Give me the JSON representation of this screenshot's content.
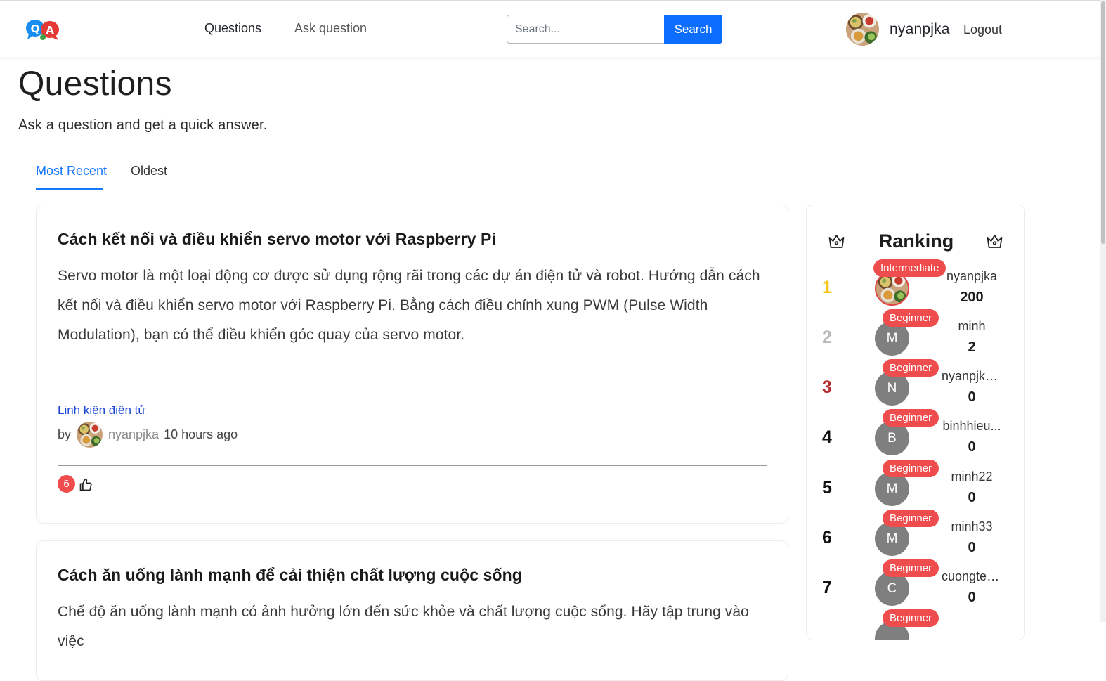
{
  "nav": {
    "links": [
      {
        "label": "Questions"
      },
      {
        "label": "Ask question"
      }
    ],
    "search_placeholder": "Search...",
    "search_button": "Search",
    "username": "nyanpjka",
    "logout": "Logout"
  },
  "header": {
    "title": "Questions",
    "subtitle": "Ask a question and get a quick answer."
  },
  "tabs": [
    {
      "label": "Most Recent",
      "active": true
    },
    {
      "label": "Oldest",
      "active": false
    }
  ],
  "questions": [
    {
      "title": "Cách kết nối và điều khiển servo motor với Raspberry Pi",
      "body": "Servo motor là một loại động cơ được sử dụng rộng rãi trong các dự án điện tử và robot. Hướng dẫn cách kết nối và điều khiển servo motor với Raspberry Pi. Bằng cách điều chỉnh xung PWM (Pulse Width Modulation), bạn có thể điều khiển góc quay của servo motor.",
      "tag": "Linh kiện điện tử",
      "by_label": "by",
      "author": "nyanpjka",
      "time": "10 hours ago",
      "likes": "6"
    },
    {
      "title": "Cách ăn uống lành mạnh để cải thiện chất lượng cuộc sống",
      "body": "Chế độ ăn uống lành mạnh có ảnh hưởng lớn đến sức khỏe và chất lượng cuộc sống. Hãy tập trung vào việc"
    }
  ],
  "ranking": {
    "title": "Ranking",
    "entries": [
      {
        "rank": "1",
        "name": "nyanpjka",
        "points": "200",
        "level": "Intermediate",
        "initial": "",
        "rank_color": "#f5c518"
      },
      {
        "rank": "2",
        "name": "minh",
        "points": "2",
        "level": "Beginner",
        "initial": "M",
        "rank_color": "#b9b9b9"
      },
      {
        "rank": "3",
        "name": "nyanpjka...",
        "points": "0",
        "level": "Beginner",
        "initial": "N",
        "rank_color": "#b52a2a"
      },
      {
        "rank": "4",
        "name": "binhhieu...",
        "points": "0",
        "level": "Beginner",
        "initial": "B",
        "rank_color": "#111111"
      },
      {
        "rank": "5",
        "name": "minh22",
        "points": "0",
        "level": "Beginner",
        "initial": "M",
        "rank_color": "#111111"
      },
      {
        "rank": "6",
        "name": "minh33",
        "points": "0",
        "level": "Beginner",
        "initial": "M",
        "rank_color": "#111111"
      },
      {
        "rank": "7",
        "name": "cuongtes...",
        "points": "0",
        "level": "Beginner",
        "initial": "C",
        "rank_color": "#111111"
      },
      {
        "rank": "",
        "name": "",
        "points": "",
        "level": "Beginner",
        "initial": "",
        "rank_color": "#111111"
      }
    ]
  },
  "colors": {
    "primary": "#0d6efd",
    "tab_active": "#1677ff",
    "badge_red": "#ef4d4d",
    "tag_link": "#1a45d6"
  },
  "icons": {
    "logo": "qa-logo-icon",
    "crown": "crown-icon",
    "like": "thumbs-up-icon",
    "avatar": "food-photo-avatar"
  }
}
